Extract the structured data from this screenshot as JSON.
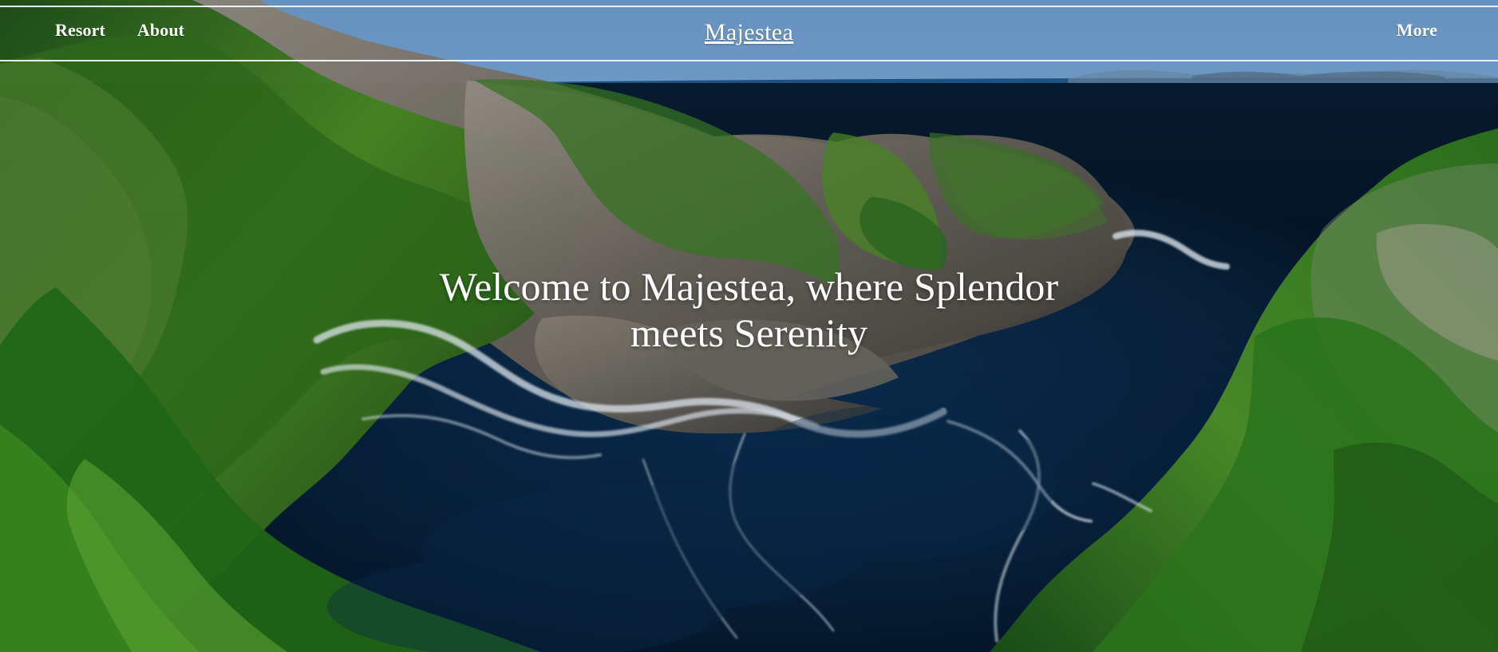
{
  "nav": {
    "left_links": [
      {
        "label": "Resort"
      },
      {
        "label": "About"
      }
    ],
    "brand": "Majestea",
    "right_link": "More"
  },
  "hero": {
    "headline": "Welcome to Majestea, where Splendor meets Serenity",
    "background": "coastal cliff cove with green vegetation, rocky islets, and deep blue sea"
  },
  "colors": {
    "sky": "#8fb8e3",
    "ocean": "#0c3157",
    "foliage": "#3f8f1f",
    "rock": "#777067",
    "text": "#ffffff"
  }
}
